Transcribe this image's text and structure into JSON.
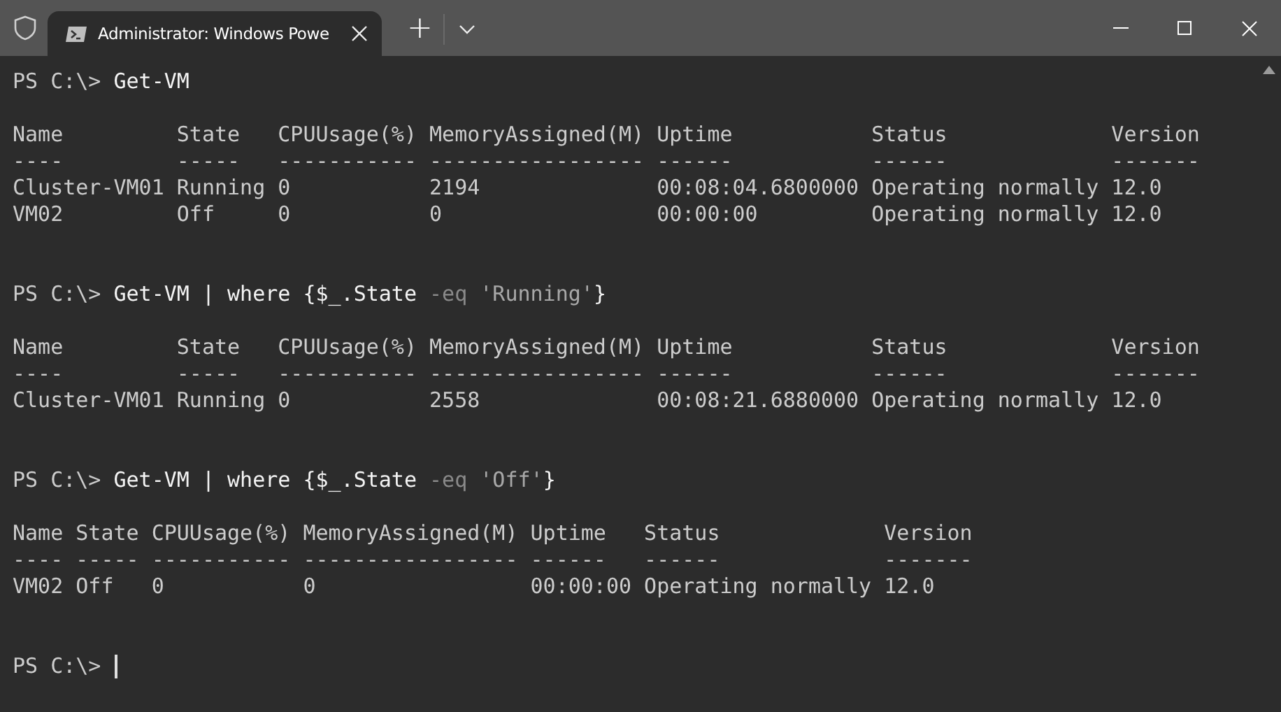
{
  "window": {
    "tab_title": "Administrator: Windows Powe",
    "new_tab": "+"
  },
  "console": [
    {
      "kind": "prompt",
      "segments": [
        {
          "kind": "prompt",
          "text": "PS C:\\> "
        },
        {
          "kind": "code",
          "text": "Get-VM"
        }
      ]
    },
    {
      "kind": "blank"
    },
    {
      "kind": "output",
      "text": "Name         State   CPUUsage(%) MemoryAssigned(M) Uptime           Status             Version"
    },
    {
      "kind": "output",
      "text": "----         -----   ----------- ----------------- ------           ------             -------"
    },
    {
      "kind": "output",
      "text": "Cluster-VM01 Running 0           2194              00:08:04.6800000 Operating normally 12.0"
    },
    {
      "kind": "output",
      "text": "VM02         Off     0           0                 00:00:00         Operating normally 12.0"
    },
    {
      "kind": "blank"
    },
    {
      "kind": "blank"
    },
    {
      "kind": "prompt",
      "segments": [
        {
          "kind": "prompt",
          "text": "PS C:\\> "
        },
        {
          "kind": "code",
          "text": "Get-VM | where {$_.State"
        },
        {
          "kind": "operator",
          "text": " -eq"
        },
        {
          "kind": "string",
          "text": " 'Running'"
        },
        {
          "kind": "code",
          "text": "}"
        }
      ]
    },
    {
      "kind": "blank"
    },
    {
      "kind": "output",
      "text": "Name         State   CPUUsage(%) MemoryAssigned(M) Uptime           Status             Version"
    },
    {
      "kind": "output",
      "text": "----         -----   ----------- ----------------- ------           ------             -------"
    },
    {
      "kind": "output",
      "text": "Cluster-VM01 Running 0           2558              00:08:21.6880000 Operating normally 12.0"
    },
    {
      "kind": "blank"
    },
    {
      "kind": "blank"
    },
    {
      "kind": "prompt",
      "segments": [
        {
          "kind": "prompt",
          "text": "PS C:\\> "
        },
        {
          "kind": "code",
          "text": "Get-VM | where {$_.State"
        },
        {
          "kind": "operator",
          "text": " -eq"
        },
        {
          "kind": "string",
          "text": " 'Off'"
        },
        {
          "kind": "code",
          "text": "}"
        }
      ]
    },
    {
      "kind": "blank"
    },
    {
      "kind": "output",
      "text": "Name State CPUUsage(%) MemoryAssigned(M) Uptime   Status             Version"
    },
    {
      "kind": "output",
      "text": "---- ----- ----------- ----------------- ------   ------             -------"
    },
    {
      "kind": "output",
      "text": "VM02 Off   0           0                 00:00:00 Operating normally 12.0"
    },
    {
      "kind": "blank"
    },
    {
      "kind": "blank"
    },
    {
      "kind": "prompt",
      "cursor": true,
      "segments": [
        {
          "kind": "prompt",
          "text": "PS C:\\> "
        }
      ]
    }
  ]
}
